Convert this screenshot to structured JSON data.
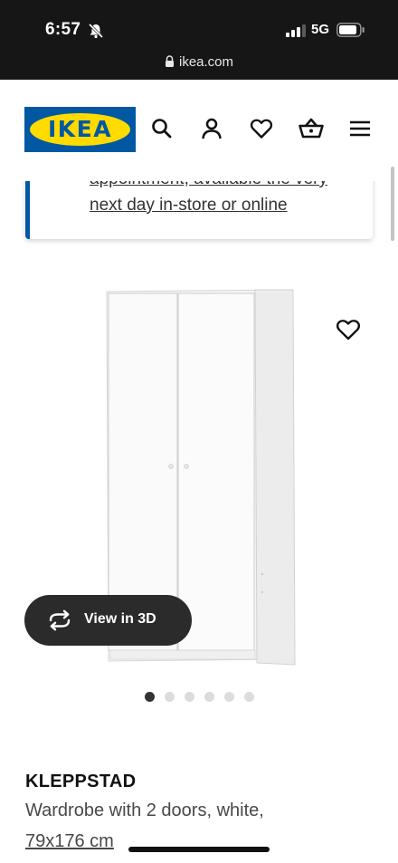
{
  "status_bar": {
    "time": "6:57",
    "network": "5G",
    "icons": [
      "bell-slash-icon",
      "signal-icon",
      "battery-icon"
    ]
  },
  "browser": {
    "url": "ikea.com",
    "icon": "lock-icon"
  },
  "header": {
    "logo_text": "IKEA",
    "icons": [
      "search-icon",
      "account-icon",
      "heart-icon",
      "cart-icon",
      "menu-icon"
    ]
  },
  "banner": {
    "partial_line": "appointment, available the very",
    "line": "next day in-store or online"
  },
  "gallery": {
    "view_3d_label": "View in 3D",
    "dot_count": 6,
    "active_index": 0
  },
  "product": {
    "name": "KLEPPSTAD",
    "description": "Wardrobe with 2 doors, white,",
    "size": "79x176 cm"
  },
  "colors": {
    "ikea_blue": "#0058a3",
    "ikea_yellow": "#ffdb00",
    "status_bar": "#161616",
    "pill": "#2b2b2b"
  }
}
